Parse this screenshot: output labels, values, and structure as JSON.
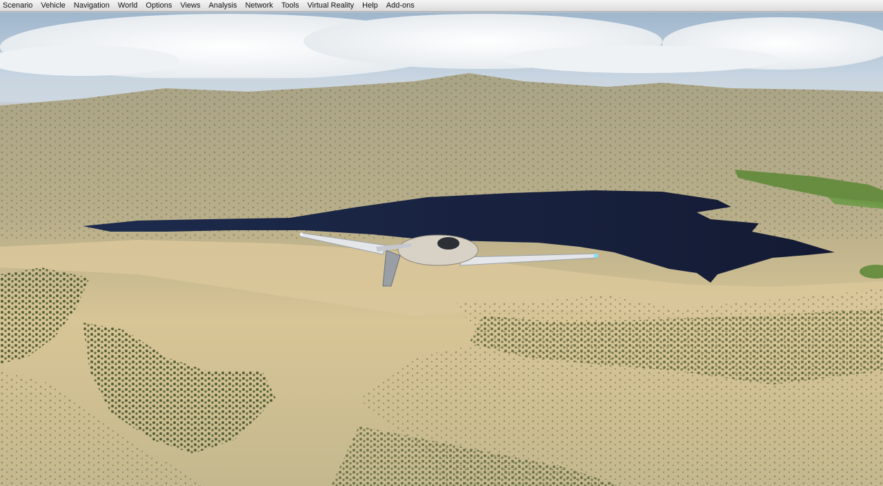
{
  "menubar": {
    "items": [
      {
        "label": "Scenario"
      },
      {
        "label": "Vehicle"
      },
      {
        "label": "Navigation"
      },
      {
        "label": "World"
      },
      {
        "label": "Options"
      },
      {
        "label": "Views"
      },
      {
        "label": "Analysis"
      },
      {
        "label": "Network"
      },
      {
        "label": "Tools"
      },
      {
        "label": "Virtual Reality"
      },
      {
        "label": "Help"
      },
      {
        "label": "Add-ons"
      }
    ]
  },
  "scene": {
    "watermark": "",
    "colors": {
      "sky_top": "#9fb6cc",
      "sky_bottom": "#d7e1ea",
      "cloud": "#f3f5f7",
      "terrain_far": "#a9a386",
      "terrain_mid": "#c6b98f",
      "terrain_near": "#d8c596",
      "lake": "#1b2340",
      "forest": "#4a5a2a",
      "fields": "#5f8a3a",
      "aircraft_body": "#d8d2c6",
      "aircraft_wing": "#e4e6ea"
    }
  }
}
